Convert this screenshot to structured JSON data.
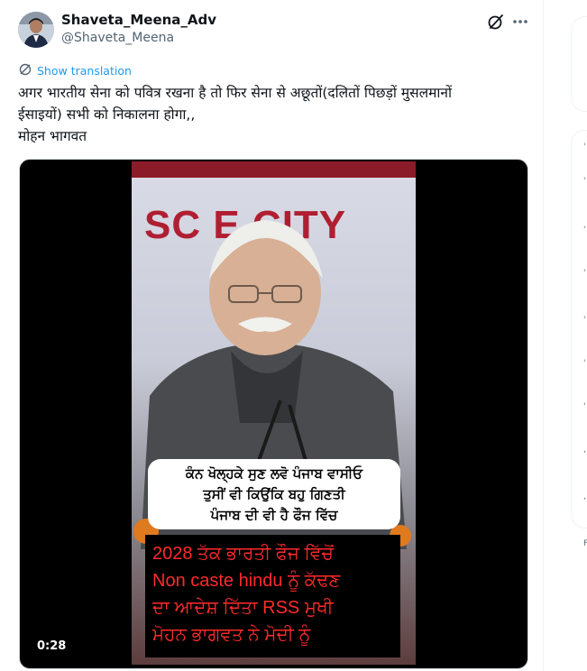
{
  "author": {
    "name": "Shaveta_Meena_Adv",
    "handle": "@Shaveta_Meena"
  },
  "actions": {
    "show_translation": "Show translation"
  },
  "tweet": {
    "lines": [
      "अगर भारतीय सेना को पवित्र रखना है तो फिर सेना से अछूतों(दलितों पिछड़ों मुसलमानों",
      "ईसाइयों) सभी को निकालना होगा,,",
      "मोहन भागवत"
    ]
  },
  "video": {
    "duration": "0:28",
    "banner_text": "SC    E CITY",
    "caption_white": [
      "ਕੰਨ ਖੋਲ੍ਹਕੇ ਸੁਣ ਲਵੋ ਪੰਜਾਬ ਵਾਸੀਓ",
      "ਤੁਸੀਂ ਵੀ ਕਿਉਂਕਿ ਬਹੁ ਗਿਣਤੀ",
      "ਪੰਜਾਬ ਦੀ ਵੀ ਹੈ ਫੌਜ ਵਿੱਚ"
    ],
    "caption_red": [
      "2028 ਤੱਕ ਭਾਰਤੀ ਫੌਜ ਵਿੱਚੋਂ",
      "Non caste hindu ਨੂੰ ਕੱਢਣ",
      "ਦਾ ਆਦੇਸ਼ ਦਿੱਤਾ RSS ਮੁਖੀ",
      "ਮੋਹਨ ਭਾਗਵਤ ਨੇ ਮੋਦੀ ਨੂੰ"
    ]
  },
  "colors": {
    "accent": "#1d9bf0",
    "text": "#0f1419",
    "secondary": "#536471",
    "caption_red": "#ff2a2a"
  },
  "right_column": {
    "glyphs": [
      "'",
      "'",
      "'",
      "'",
      "'",
      "'",
      "'",
      ",",
      ",",
      "F"
    ]
  }
}
